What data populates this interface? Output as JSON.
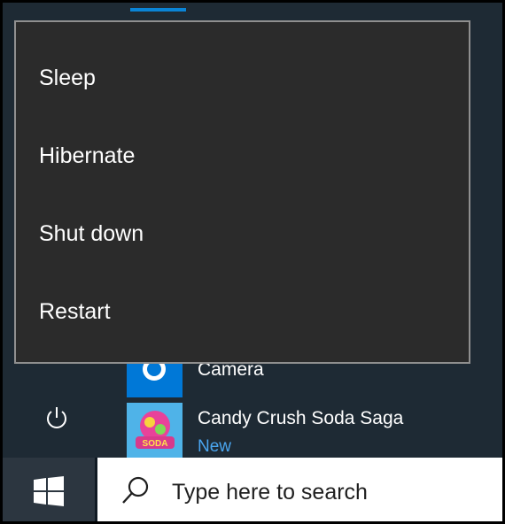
{
  "power_menu": {
    "items": [
      {
        "label": "Sleep"
      },
      {
        "label": "Hibernate"
      },
      {
        "label": "Shut down"
      },
      {
        "label": "Restart"
      }
    ]
  },
  "apps": [
    {
      "label": "Camera",
      "icon": "camera-icon"
    },
    {
      "label": "Candy Crush Soda Saga",
      "badge": "New",
      "icon": "candy-crush-icon"
    }
  ],
  "rail": {
    "power_icon": "power-icon"
  },
  "taskbar": {
    "start_icon": "windows-logo-icon",
    "search_placeholder": "Type here to search",
    "search_icon": "search-icon"
  },
  "colors": {
    "accent": "#0078d7",
    "menu_bg": "#2b2b2b",
    "start_bg": "#1e2a34",
    "taskbar_bg": "#101a23",
    "new_badge": "#4aa6f0"
  }
}
